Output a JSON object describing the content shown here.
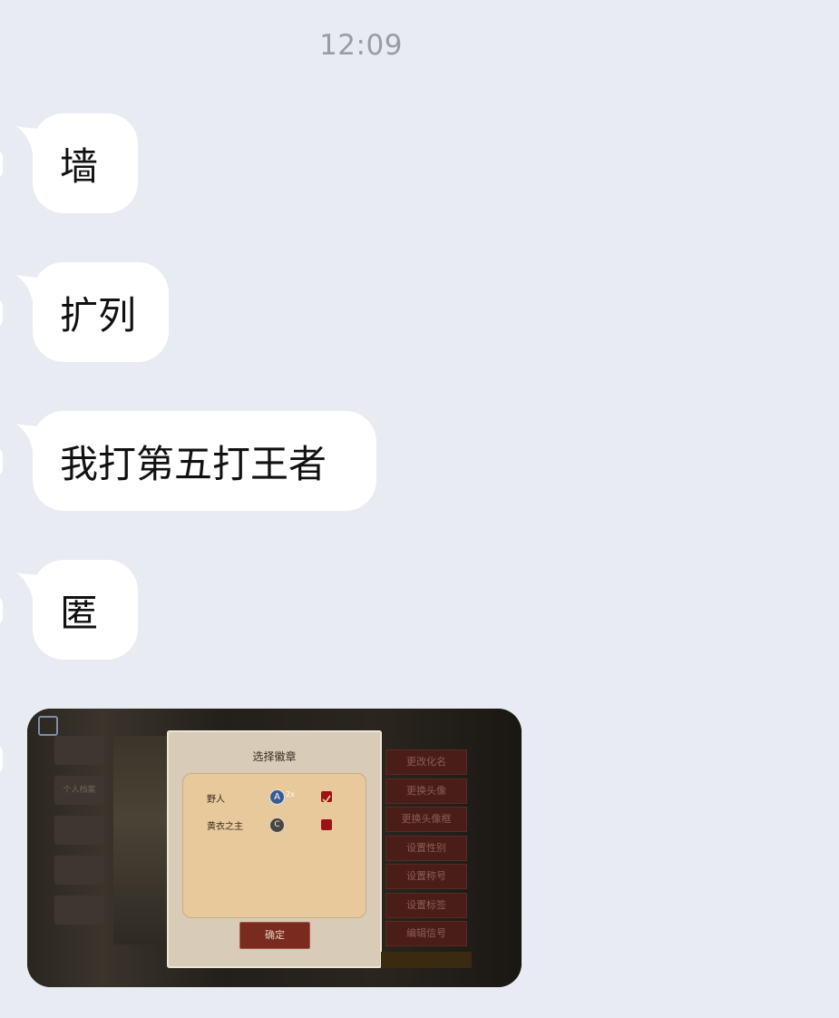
{
  "timestamp": "12:09",
  "messages": [
    {
      "text": "墙"
    },
    {
      "text": "扩列"
    },
    {
      "text": "我打第五打王者"
    },
    {
      "text": "匿"
    }
  ],
  "image_message": {
    "panel_title": "选择徽章",
    "rows": [
      {
        "name": "野人",
        "badge_text": "A",
        "badge_extra": "2x"
      },
      {
        "name": "黄衣之主",
        "badge_text": "C",
        "badge_extra": ""
      }
    ],
    "confirm_label": "确定",
    "right_buttons": [
      "更改化名",
      "更换头像",
      "更换头像框",
      "设置性别",
      "设置称号",
      "设置标签",
      "编辑信号"
    ],
    "left_menu": [
      "",
      "个人档案",
      "",
      "",
      ""
    ],
    "bottom_strip_text": ""
  },
  "colors": {
    "background": "#e9ebf2",
    "bubble": "#ffffff",
    "timestamp": "#9a9ca3"
  }
}
